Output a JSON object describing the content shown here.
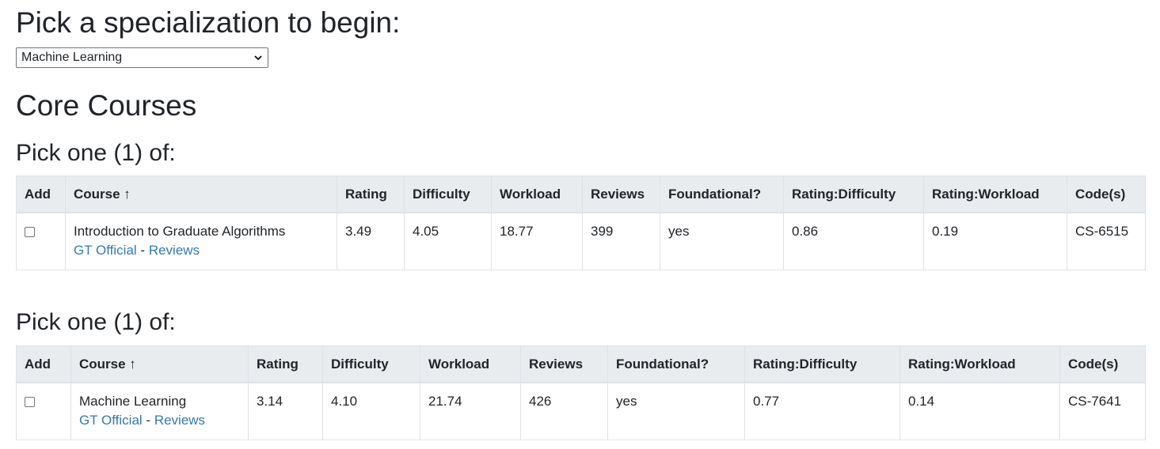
{
  "page": {
    "title": "Pick a specialization to begin:",
    "select": {
      "value": "Machine Learning"
    },
    "core_heading": "Core Courses"
  },
  "groups": [
    {
      "heading": "Pick one (1) of:",
      "headers": [
        "Add",
        "Course ↑",
        "Rating",
        "Difficulty",
        "Workload",
        "Reviews",
        "Foundational?",
        "Rating:Difficulty",
        "Rating:Workload",
        "Code(s)"
      ],
      "rows": [
        {
          "course": "Introduction to Graduate Algorithms",
          "link_official": "GT Official",
          "link_sep": "-",
          "link_reviews": "Reviews",
          "rating": "3.49",
          "difficulty": "4.05",
          "workload": "18.77",
          "reviews": "399",
          "foundational": "yes",
          "rating_difficulty": "0.86",
          "rating_workload": "0.19",
          "codes": "CS-6515"
        }
      ]
    },
    {
      "heading": "Pick one (1) of:",
      "headers": [
        "Add",
        "Course ↑",
        "Rating",
        "Difficulty",
        "Workload",
        "Reviews",
        "Foundational?",
        "Rating:Difficulty",
        "Rating:Workload",
        "Code(s)"
      ],
      "rows": [
        {
          "course": "Machine Learning",
          "link_official": "GT Official",
          "link_sep": "-",
          "link_reviews": "Reviews",
          "rating": "3.14",
          "difficulty": "4.10",
          "workload": "21.74",
          "reviews": "426",
          "foundational": "yes",
          "rating_difficulty": "0.77",
          "rating_workload": "0.14",
          "codes": "CS-7641"
        }
      ]
    }
  ],
  "colors": {
    "link": "#337ab7",
    "header_bg": "#e9ecef",
    "border": "#dee2e6"
  }
}
